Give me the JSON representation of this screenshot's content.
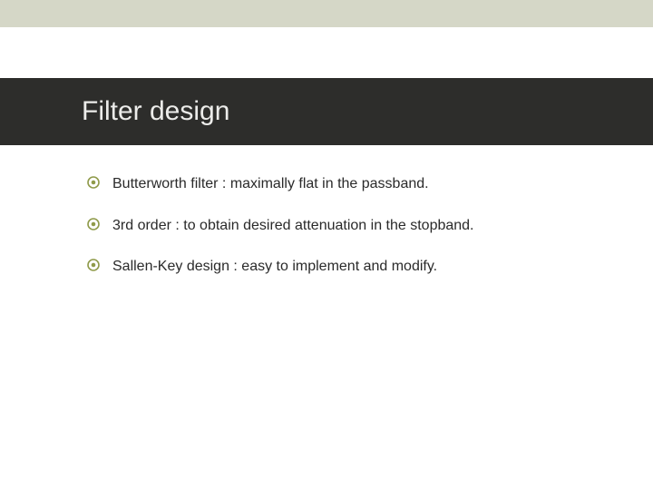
{
  "title": "Filter design",
  "bullets": [
    {
      "text": "Butterworth filter : maximally flat in the passband."
    },
    {
      "text": "3rd order : to obtain desired attenuation in the stopband."
    },
    {
      "text": "Sallen-Key design : easy to implement and modify."
    }
  ]
}
